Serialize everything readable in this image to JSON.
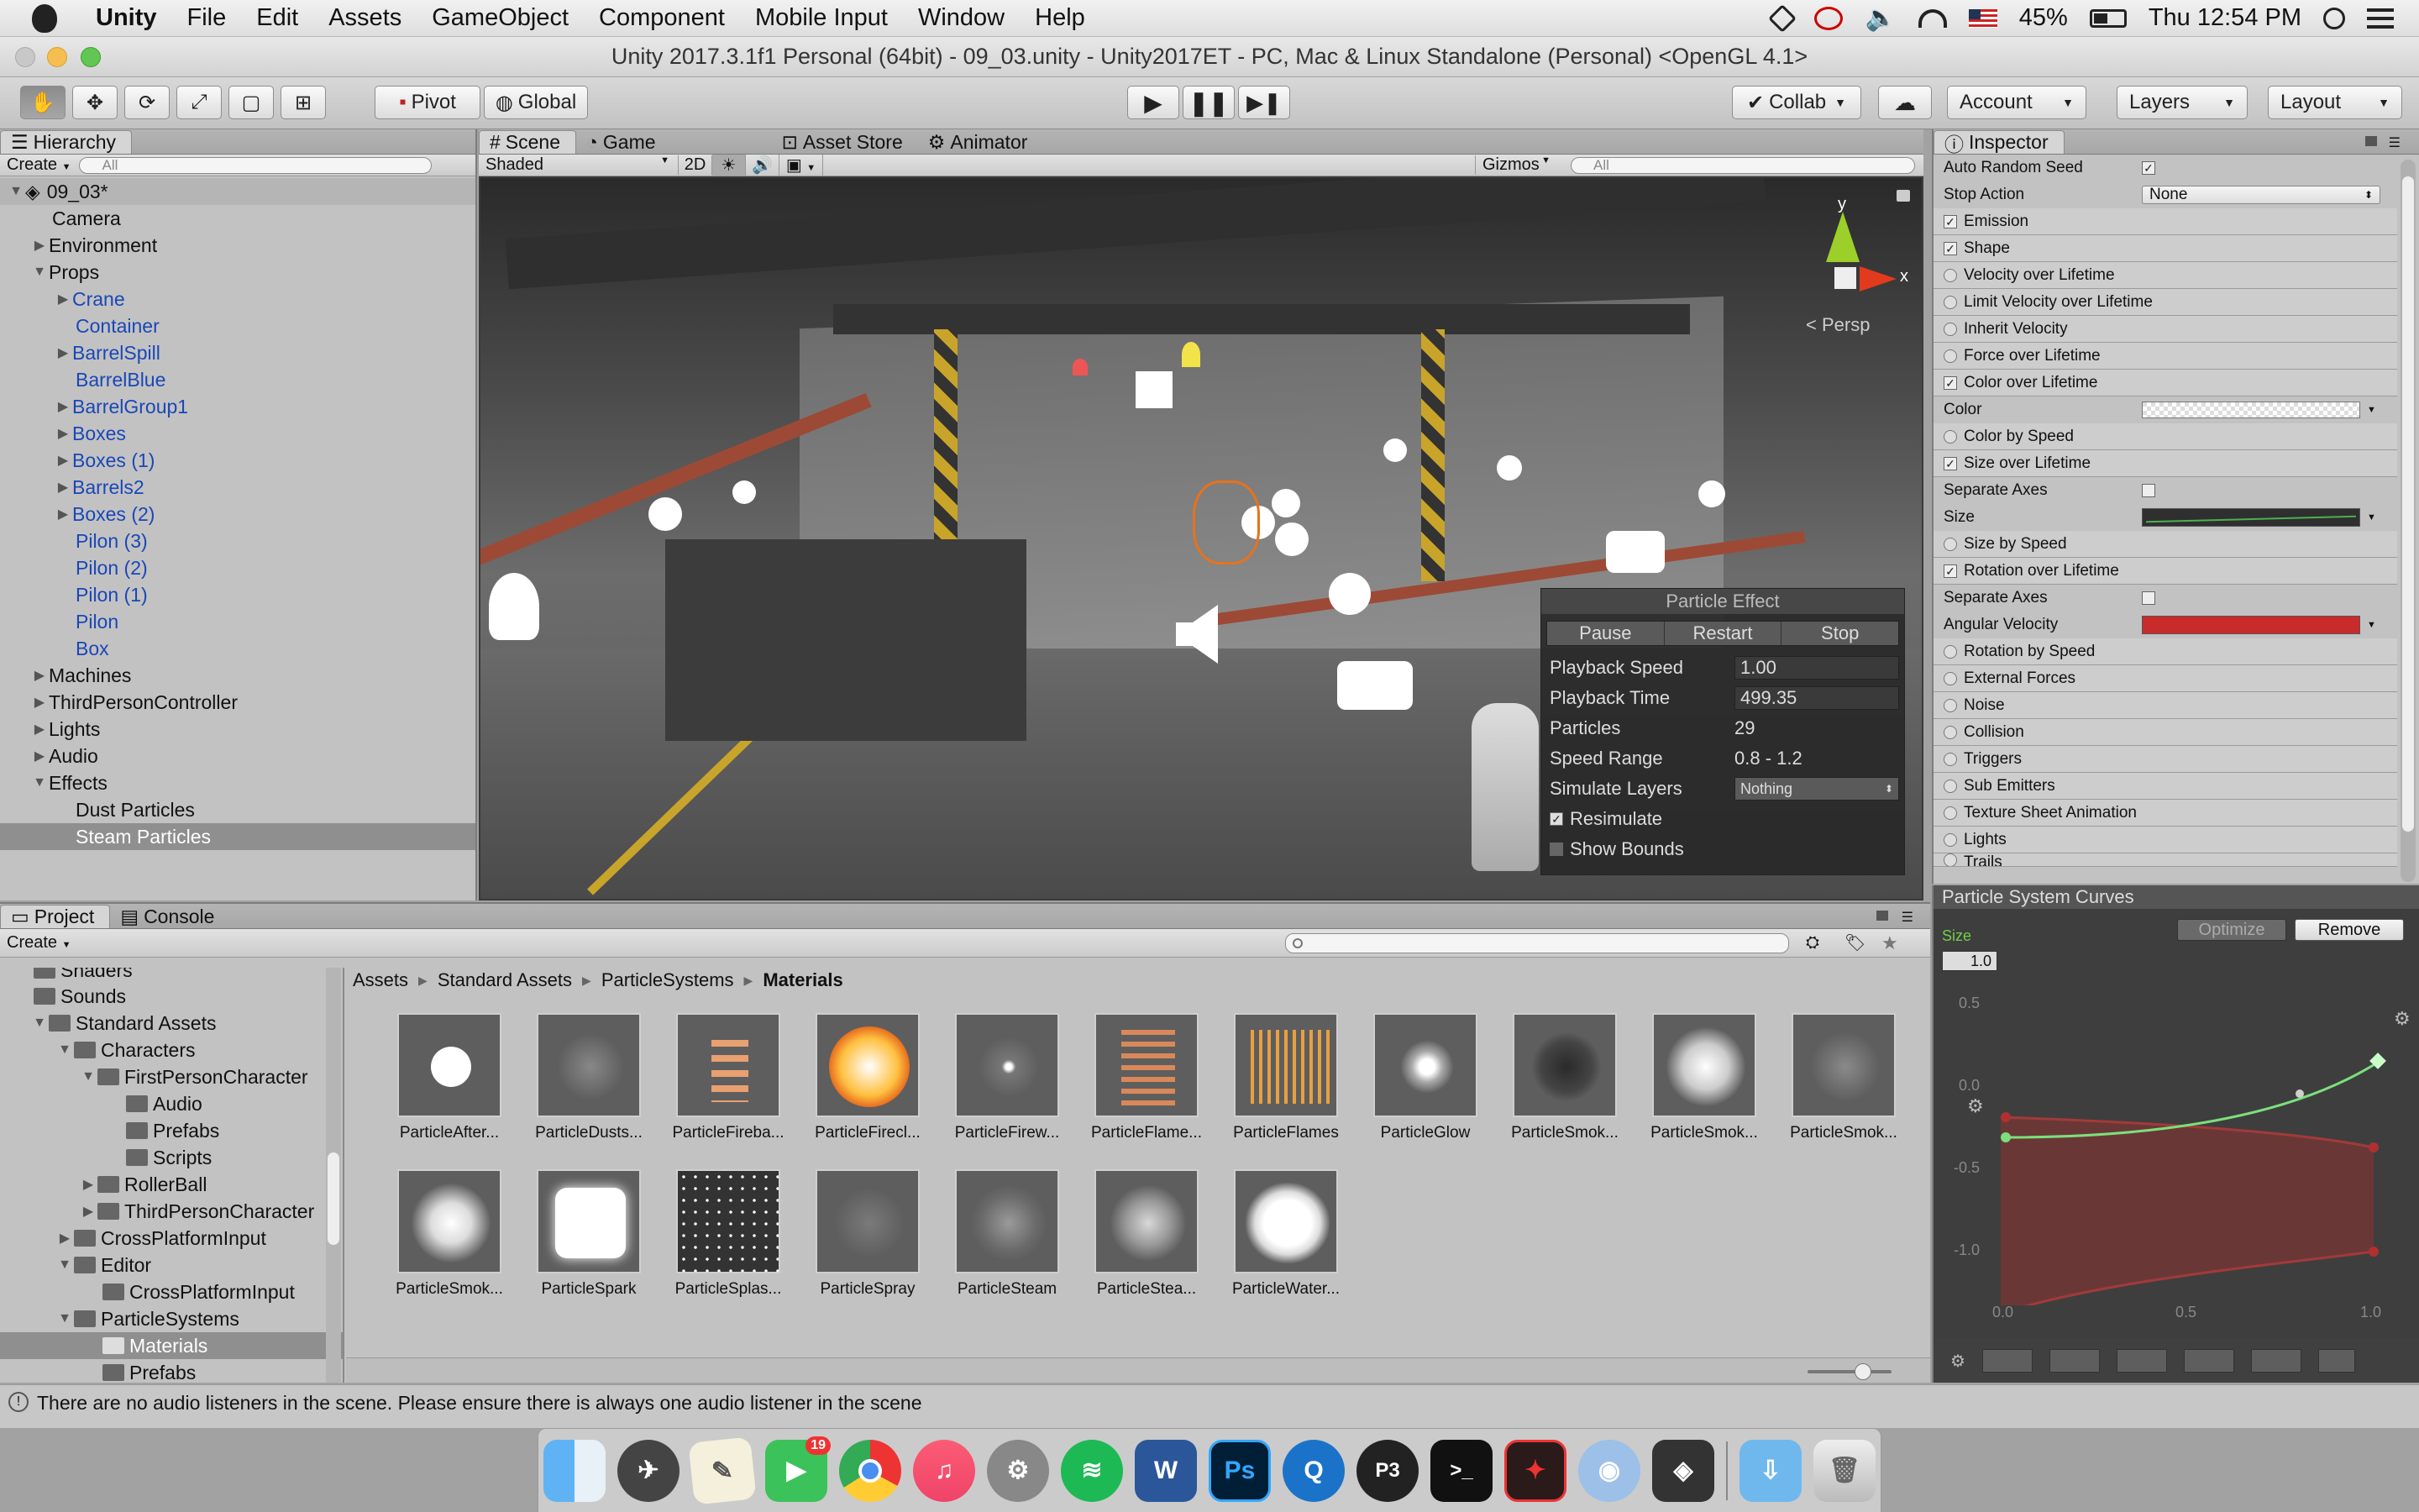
{
  "menubar": {
    "app": "Unity",
    "items": [
      "File",
      "Edit",
      "Assets",
      "GameObject",
      "Component",
      "Mobile Input",
      "Window",
      "Help"
    ],
    "battery": "45%",
    "clock": "Thu 12:54 PM"
  },
  "window": {
    "title": "Unity 2017.3.1f1 Personal (64bit) - 09_03.unity - Unity2017ET - PC, Mac & Linux Standalone (Personal) <OpenGL 4.1>"
  },
  "toolbar": {
    "pivot": "Pivot",
    "global": "Global",
    "collab": "Collab",
    "account": "Account",
    "layers": "Layers",
    "layout": "Layout"
  },
  "hierarchy": {
    "tab": "Hierarchy",
    "create": "Create",
    "search_placeholder": "All",
    "scene": "09_03*",
    "items": [
      {
        "label": "Camera"
      },
      {
        "label": "Environment"
      },
      {
        "label": "Props"
      },
      {
        "label": "Crane"
      },
      {
        "label": "Container"
      },
      {
        "label": "BarrelSpill"
      },
      {
        "label": "BarrelBlue"
      },
      {
        "label": "BarrelGroup1"
      },
      {
        "label": "Boxes"
      },
      {
        "label": "Boxes (1)"
      },
      {
        "label": "Barrels2"
      },
      {
        "label": "Boxes (2)"
      },
      {
        "label": "Pilon (3)"
      },
      {
        "label": "Pilon (2)"
      },
      {
        "label": "Pilon (1)"
      },
      {
        "label": "Pilon"
      },
      {
        "label": "Box"
      },
      {
        "label": "Machines"
      },
      {
        "label": "ThirdPersonController"
      },
      {
        "label": "Lights"
      },
      {
        "label": "Audio"
      },
      {
        "label": "Effects"
      },
      {
        "label": "Dust Particles"
      },
      {
        "label": "Steam Particles"
      }
    ]
  },
  "scene": {
    "tabs": [
      "Scene",
      "Game",
      "Asset Store",
      "Animator"
    ],
    "shading": "Shaded",
    "mode2d": "2D",
    "gizmos": "Gizmos",
    "search_placeholder": "All",
    "persp": "< Persp",
    "axis_y": "y",
    "axis_x": "x"
  },
  "particle_effect": {
    "title": "Particle Effect",
    "pause": "Pause",
    "restart": "Restart",
    "stop": "Stop",
    "playback_speed_label": "Playback Speed",
    "playback_speed": "1.00",
    "playback_time_label": "Playback Time",
    "playback_time": "499.35",
    "particles_label": "Particles",
    "particles": "29",
    "speed_range_label": "Speed Range",
    "speed_range": "0.8 - 1.2",
    "simulate_layers_label": "Simulate Layers",
    "simulate_layers": "Nothing",
    "resimulate": "Resimulate",
    "show_bounds": "Show Bounds"
  },
  "inspector": {
    "tab": "Inspector",
    "auto_random_seed": "Auto Random Seed",
    "stop_action": "Stop Action",
    "stop_action_value": "None",
    "modules": {
      "emission": "Emission",
      "shape": "Shape",
      "velocity": "Velocity over Lifetime",
      "limit_velocity": "Limit Velocity over Lifetime",
      "inherit": "Inherit Velocity",
      "force": "Force over Lifetime",
      "color": "Color over Lifetime",
      "color_by_speed": "Color by Speed",
      "size": "Size over Lifetime",
      "size_by_speed": "Size by Speed",
      "rotation": "Rotation over Lifetime",
      "rotation_by_speed": "Rotation by Speed",
      "external": "External Forces",
      "noise": "Noise",
      "collision": "Collision",
      "triggers": "Triggers",
      "sub_emitters": "Sub Emitters",
      "texture_sheet": "Texture Sheet Animation",
      "lights": "Lights",
      "trails": "Trails"
    },
    "color_label": "Color",
    "separate_axes": "Separate Axes",
    "size_label": "Size",
    "angular_velocity": "Angular Velocity"
  },
  "curves": {
    "title": "Particle System Curves",
    "optimize": "Optimize",
    "remove": "Remove",
    "curve_name": "Size",
    "max_value": "1.0",
    "y_ticks": [
      "0.5",
      "0.0",
      "-0.5",
      "-1.0"
    ],
    "x_ticks": [
      "0.0",
      "0.5",
      "1.0"
    ]
  },
  "project": {
    "tabs": [
      "Project",
      "Console"
    ],
    "create": "Create",
    "tree": [
      {
        "label": "Shaders"
      },
      {
        "label": "Sounds"
      },
      {
        "label": "Standard Assets"
      },
      {
        "label": "Characters"
      },
      {
        "label": "FirstPersonCharacter"
      },
      {
        "label": "Audio"
      },
      {
        "label": "Prefabs"
      },
      {
        "label": "Scripts"
      },
      {
        "label": "RollerBall"
      },
      {
        "label": "ThirdPersonCharacter"
      },
      {
        "label": "CrossPlatformInput"
      },
      {
        "label": "Editor"
      },
      {
        "label": "CrossPlatformInput"
      },
      {
        "label": "ParticleSystems"
      },
      {
        "label": "Materials"
      },
      {
        "label": "Prefabs"
      }
    ],
    "breadcrumb": [
      "Assets",
      "Standard Assets",
      "ParticleSystems",
      "Materials"
    ],
    "assets": [
      "ParticleAfter...",
      "ParticleDusts...",
      "ParticleFireba...",
      "ParticleFirecl...",
      "ParticleFirew...",
      "ParticleFlame...",
      "ParticleFlames",
      "ParticleGlow",
      "ParticleSmok...",
      "ParticleSmok...",
      "ParticleSmok...",
      "ParticleSmok...",
      "ParticleSpark",
      "ParticleSplas...",
      "ParticleSpray",
      "ParticleSteam",
      "ParticleStea...",
      "ParticleWater..."
    ]
  },
  "status": {
    "message": "There are no audio listeners in the scene. Please ensure there is always one audio listener in the scene"
  },
  "dock": {
    "badge": "19",
    "ps": "Ps",
    "word": "W",
    "pthree": "P3",
    "terminal": ">_"
  }
}
